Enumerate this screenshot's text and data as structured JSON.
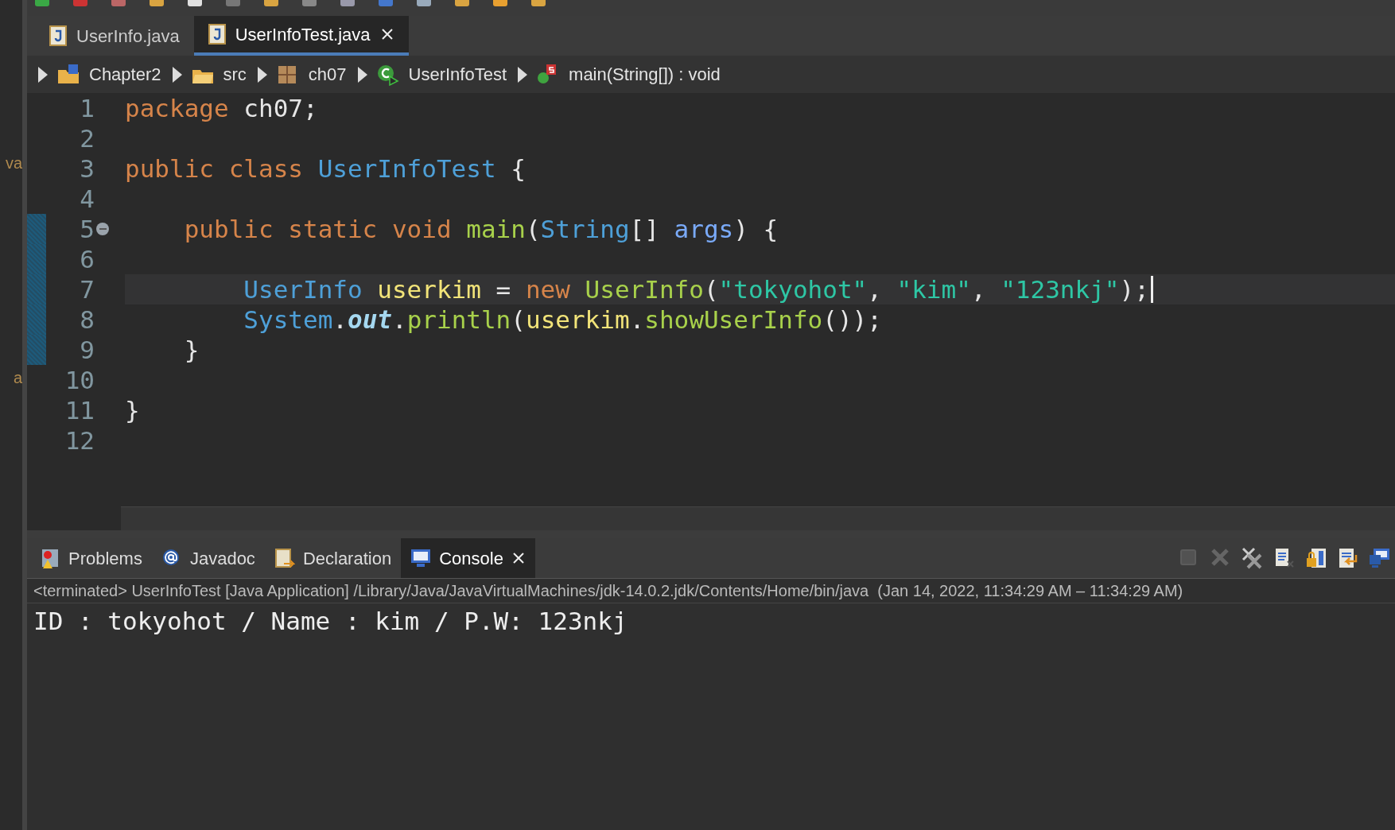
{
  "editor_tabs": [
    {
      "label": "UserInfo.java",
      "selected": false,
      "closable": false
    },
    {
      "label": "UserInfoTest.java",
      "selected": true,
      "closable": true
    }
  ],
  "breadcrumb": [
    {
      "label": "Chapter2",
      "kind": "project"
    },
    {
      "label": "src",
      "kind": "folder"
    },
    {
      "label": "ch07",
      "kind": "package"
    },
    {
      "label": "UserInfoTest",
      "kind": "class"
    },
    {
      "label": "main(String[]) : void",
      "kind": "method"
    }
  ],
  "side_fragments": [
    "va",
    "a"
  ],
  "code_lines": [
    {
      "number": "1",
      "changed": false,
      "current": false,
      "foldable": false,
      "tokens": [
        {
          "kind": "keyword",
          "text": "package "
        },
        {
          "kind": "plain",
          "text": "ch07;"
        }
      ]
    },
    {
      "number": "2",
      "changed": false,
      "current": false,
      "foldable": false
    },
    {
      "number": "3",
      "changed": false,
      "current": false,
      "foldable": false,
      "tokens": [
        {
          "kind": "keyword",
          "text": "public class "
        },
        {
          "kind": "type",
          "text": "UserInfoTest "
        },
        {
          "kind": "plain",
          "text": "{"
        }
      ]
    },
    {
      "number": "4",
      "changed": false,
      "current": false,
      "foldable": false
    },
    {
      "number": "5",
      "changed": true,
      "current": false,
      "foldable": true,
      "tokens": [
        {
          "kind": "keyword",
          "text": "    public static void "
        },
        {
          "kind": "method",
          "text": "main"
        },
        {
          "kind": "plain",
          "text": "("
        },
        {
          "kind": "type",
          "text": "String"
        },
        {
          "kind": "plain",
          "text": "[] "
        },
        {
          "kind": "param",
          "text": "args"
        },
        {
          "kind": "plain",
          "text": ") {"
        }
      ]
    },
    {
      "number": "6",
      "changed": true,
      "current": false,
      "foldable": false
    },
    {
      "number": "7",
      "changed": true,
      "current": true,
      "foldable": false,
      "tokens": [
        {
          "kind": "type",
          "text": "        UserInfo "
        },
        {
          "kind": "variable",
          "text": "userkim"
        },
        {
          "kind": "plain",
          "text": " = "
        },
        {
          "kind": "keyword",
          "text": "new "
        },
        {
          "kind": "method",
          "text": "UserInfo"
        },
        {
          "kind": "plain",
          "text": "("
        },
        {
          "kind": "string",
          "text": "\"tokyohot\""
        },
        {
          "kind": "plain",
          "text": ", "
        },
        {
          "kind": "string",
          "text": "\"kim\""
        },
        {
          "kind": "plain",
          "text": ", "
        },
        {
          "kind": "string",
          "text": "\"123nkj\""
        },
        {
          "kind": "plain",
          "text": ");"
        }
      ]
    },
    {
      "number": "8",
      "changed": true,
      "current": false,
      "foldable": false,
      "tokens": [
        {
          "kind": "type",
          "text": "        System"
        },
        {
          "kind": "plain",
          "text": "."
        },
        {
          "kind": "field",
          "text": "out"
        },
        {
          "kind": "plain",
          "text": "."
        },
        {
          "kind": "method",
          "text": "println"
        },
        {
          "kind": "plain",
          "text": "("
        },
        {
          "kind": "variable",
          "text": "userkim"
        },
        {
          "kind": "plain",
          "text": "."
        },
        {
          "kind": "method",
          "text": "showUserInfo"
        },
        {
          "kind": "plain",
          "text": "());"
        }
      ]
    },
    {
      "number": "9",
      "changed": true,
      "current": false,
      "foldable": false,
      "tokens": [
        {
          "kind": "plain",
          "text": "    }"
        }
      ]
    },
    {
      "number": "10",
      "changed": false,
      "current": false,
      "foldable": false
    },
    {
      "number": "11",
      "changed": false,
      "current": false,
      "foldable": false,
      "tokens": [
        {
          "kind": "plain",
          "text": "}"
        }
      ]
    },
    {
      "number": "12",
      "changed": false,
      "current": false,
      "foldable": false
    }
  ],
  "panel_tabs": [
    {
      "label": "Problems",
      "kind": "problems",
      "selected": false,
      "closable": false
    },
    {
      "label": "Javadoc",
      "kind": "javadoc",
      "selected": false,
      "closable": false
    },
    {
      "label": "Declaration",
      "kind": "declaration",
      "selected": false,
      "closable": false
    },
    {
      "label": "Console",
      "kind": "console",
      "selected": true,
      "closable": true
    }
  ],
  "console": {
    "description": "<terminated> UserInfoTest [Java Application] /Library/Java/JavaVirtualMachines/jdk-14.0.2.jdk/Contents/Home/bin/java  (Jan 14, 2022, 11:34:29 AM – 11:34:29 AM)",
    "output": [
      "ID : tokyohot / Name : kim / P.W: 123nkj"
    ],
    "actions": [
      {
        "kind": "terminate",
        "disabled": true
      },
      {
        "kind": "remove",
        "disabled": true
      },
      {
        "kind": "remove-all",
        "disabled": false
      },
      {
        "kind": "clear",
        "disabled": false
      },
      {
        "kind": "scroll-lock",
        "disabled": false
      },
      {
        "kind": "word-wrap",
        "disabled": false
      },
      {
        "kind": "display",
        "disabled": false
      }
    ]
  }
}
